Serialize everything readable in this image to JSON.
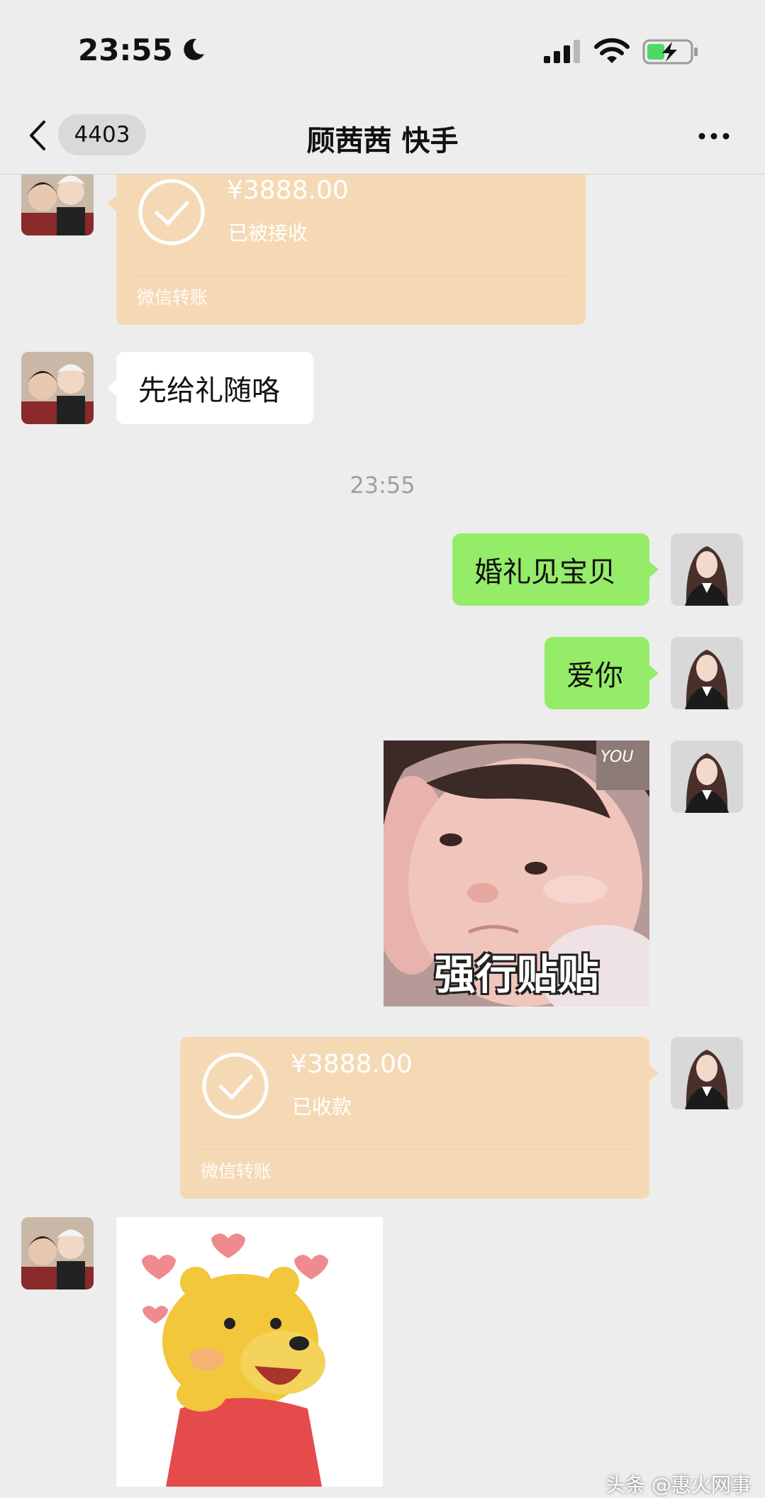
{
  "status_bar": {
    "time": "23:55",
    "icons": [
      "moon-icon",
      "signal-icon",
      "wifi-icon",
      "battery-charging-icon"
    ]
  },
  "nav": {
    "back_icon": "chevron-left-icon",
    "unread_count": "4403",
    "title": "顾茜茜 快手",
    "more_icon": "more-dots-icon"
  },
  "messages": {
    "transfer_received": {
      "amount": "¥3888.00",
      "status": "已被接收",
      "brand": "微信转账"
    },
    "text_gift": "先给礼随咯",
    "timestamp": "23:55",
    "text_wedding": "婚礼见宝贝",
    "text_love": "爱你",
    "sticker_baby": {
      "caption": "强行贴贴"
    },
    "transfer_accepted": {
      "amount": "¥3888.00",
      "status": "已收款",
      "brand": "微信转账"
    }
  },
  "watermark": "头条 @惠火网事",
  "colors": {
    "background": "#ededed",
    "green_bubble": "#95ec69",
    "transfer_card": "#f5d9b5",
    "white_bubble": "#ffffff"
  }
}
